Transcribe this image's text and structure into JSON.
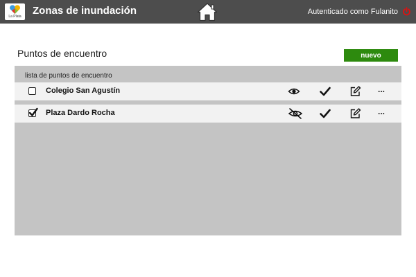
{
  "header": {
    "logo_text": "La Plata",
    "title": "Zonas de inundación",
    "home_icon": "home-icon",
    "user_text": "Autenticado como Fulanito",
    "logout_icon": "power-icon",
    "logout_color": "#e01010"
  },
  "main": {
    "section_title": "Puntos de encuentro",
    "new_button_label": "nuevo",
    "new_button_color": "#2d8a0e",
    "list_title": "lista de puntos de encuentro",
    "rows": [
      {
        "label": "Colegio San Agustín",
        "checked": false,
        "visibility_icon": "eye-icon",
        "confirm_icon": "check-icon",
        "edit_icon": "edit-icon",
        "more_label": "..."
      },
      {
        "label": "Plaza Dardo Rocha",
        "checked": true,
        "visibility_icon": "eye-slash-icon",
        "confirm_icon": "check-icon",
        "edit_icon": "edit-icon",
        "more_label": "..."
      }
    ]
  }
}
